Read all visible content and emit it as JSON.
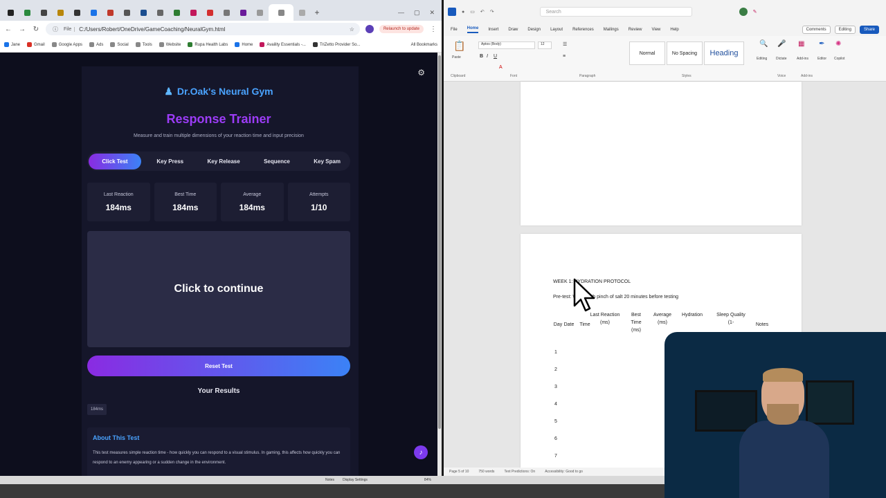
{
  "browser": {
    "tabs_count": 19,
    "tab_colors": [
      "#222",
      "#2b8a3e",
      "#444",
      "#b8860b",
      "#333",
      "#1a73e8",
      "#c0392b",
      "#555",
      "#1a4d8f",
      "#666",
      "#2e7d32",
      "#c2185b",
      "#d32f2f",
      "#777",
      "#6a1b9a",
      "#999",
      "#888",
      "#aaa"
    ],
    "address": "C:/Users/Robert/OneDrive/GameCoaching/NeuralGym.html",
    "address_chip": "File",
    "relaunch": "Relaunch to update",
    "bookmarks": [
      {
        "label": "Jane",
        "color": "#1a73e8"
      },
      {
        "label": "Gmail",
        "color": "#d93025"
      },
      {
        "label": "Google Apps",
        "color": "#888"
      },
      {
        "label": "Ads",
        "color": "#888"
      },
      {
        "label": "Social",
        "color": "#888"
      },
      {
        "label": "Tools",
        "color": "#888"
      },
      {
        "label": "Website",
        "color": "#888"
      },
      {
        "label": "Rupa Health Labs",
        "color": "#2e7d32"
      },
      {
        "label": "Home",
        "color": "#1a73e8"
      },
      {
        "label": "Availity Essentials -...",
        "color": "#c2185b"
      },
      {
        "label": "TriZetto Provider So...",
        "color": "#333"
      }
    ],
    "bookmarks_all": "All Bookmarks"
  },
  "app": {
    "brand": "Dr.Oak's Neural Gym",
    "title": "Response Trainer",
    "subtitle": "Measure and train multiple dimensions of your reaction time and input precision",
    "modes": [
      "Click Test",
      "Key Press",
      "Key Release",
      "Sequence",
      "Key Spam"
    ],
    "active_mode": 0,
    "stats": [
      {
        "label": "Last Reaction",
        "value": "184ms"
      },
      {
        "label": "Best Time",
        "value": "184ms"
      },
      {
        "label": "Average",
        "value": "184ms"
      },
      {
        "label": "Attempts",
        "value": "1/10"
      }
    ],
    "prompt": "Click to continue",
    "reset_label": "Reset Test",
    "results_title": "Your Results",
    "results": [
      "184ms"
    ],
    "about_title": "About This Test",
    "about_text": "This test measures simple reaction time - how quickly you can respond to a visual stimulus. In gaming, this affects how quickly you can respond to an enemy appearing or a sudden change in the environment."
  },
  "word": {
    "search_placeholder": "Search",
    "menu": [
      "File",
      "Home",
      "Insert",
      "Draw",
      "Design",
      "Layout",
      "References",
      "Mailings",
      "Review",
      "View",
      "Help"
    ],
    "active_menu": 1,
    "comments": "Comments",
    "editing": "Editing",
    "share": "Share",
    "font_name": "Aptos (Body)",
    "font_size": "12",
    "styles": [
      "Normal",
      "No Spacing",
      "Heading"
    ],
    "groups": [
      "Clipboard",
      "Font",
      "Paragraph",
      "Styles",
      "Voice",
      "Add-ins"
    ],
    "right_tools": [
      "Editing",
      "Dictate",
      "Add-ins",
      "Editor",
      "Copilot"
    ],
    "paste_label": "Paste",
    "doc": {
      "heading": "WEEK 1: HYDRATION PROTOCOL",
      "pretest": "Pre-test: Water with pinch of salt 20 minutes before testing",
      "columns": [
        "Day",
        "Date",
        "Time",
        "Last Reaction (ms)",
        "Best Time (ms)",
        "Average (ms)",
        "Hydration",
        "Sleep Quality (1-",
        "Notes"
      ],
      "rows": [
        "1",
        "2",
        "3",
        "4",
        "5",
        "6",
        "7"
      ]
    },
    "status": [
      "Page 5 of 10",
      "750 words",
      "Text Predictions: On",
      "Accessibility: Good to go"
    ],
    "taskbar_items": [
      "Notes",
      "Display Settings"
    ],
    "zoom": "84%"
  }
}
